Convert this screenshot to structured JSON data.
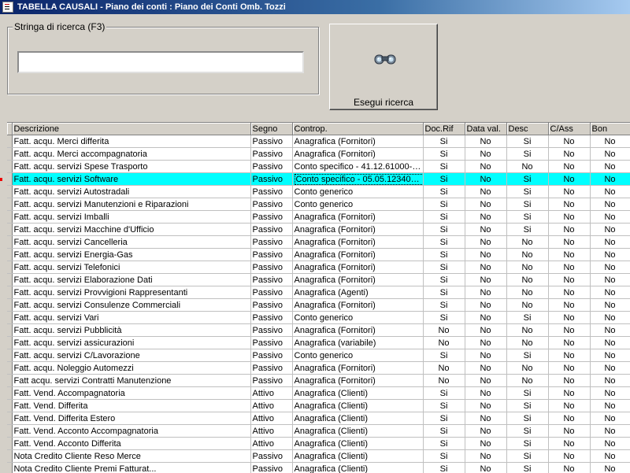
{
  "window": {
    "title": "TABELLA CAUSALI - Piano dei conti : Piano dei Conti Omb. Tozzi"
  },
  "search": {
    "legend": "Stringa di ricerca (F3)",
    "value": "",
    "placeholder": "",
    "button_label": "Esegui ricerca"
  },
  "grid": {
    "columns": [
      "Descrizione",
      "Segno",
      "Controp.",
      "Doc.Rif",
      "Data val.",
      "Desc",
      "C/Ass",
      "Bon"
    ],
    "selected_row": 3,
    "rows": [
      [
        "Fatt. acqu. Merci differita",
        "Passivo",
        "Anagrafica (Fornitori)",
        "Si",
        "No",
        "Si",
        "No",
        "No"
      ],
      [
        "Fatt. acqu. Merci accompagnatoria",
        "Passivo",
        "Anagrafica (Fornitori)",
        "Si",
        "No",
        "Si",
        "No",
        "No"
      ],
      [
        "Fatt. acqu. servizi Spese Trasporto",
        "Passivo",
        "Conto specifico - 41.12.61000-tr...",
        "Si",
        "No",
        "No",
        "No",
        "No"
      ],
      [
        "Fatt. acqu. servizi Software",
        "Passivo",
        "Conto specifico - 05.05.12340-S...",
        "Si",
        "No",
        "Si",
        "No",
        "No"
      ],
      [
        "Fatt. acqu. servizi Autostradali",
        "Passivo",
        "Conto generico",
        "Si",
        "No",
        "Si",
        "No",
        "No"
      ],
      [
        "Fatt. acqu. servizi Manutenzioni e Riparazioni",
        "Passivo",
        "Conto generico",
        "Si",
        "No",
        "Si",
        "No",
        "No"
      ],
      [
        "Fatt. acqu. servizi Imballi",
        "Passivo",
        "Anagrafica (Fornitori)",
        "Si",
        "No",
        "Si",
        "No",
        "No"
      ],
      [
        "Fatt. acqu. servizi Macchine d'Ufficio",
        "Passivo",
        "Anagrafica (Fornitori)",
        "Si",
        "No",
        "Si",
        "No",
        "No"
      ],
      [
        "Fatt. acqu. servizi Cancelleria",
        "Passivo",
        "Anagrafica (Fornitori)",
        "Si",
        "No",
        "No",
        "No",
        "No"
      ],
      [
        "Fatt. acqu. servizi Energia-Gas",
        "Passivo",
        "Anagrafica (Fornitori)",
        "Si",
        "No",
        "No",
        "No",
        "No"
      ],
      [
        "Fatt. acqu. servizi Telefonici",
        "Passivo",
        "Anagrafica (Fornitori)",
        "Si",
        "No",
        "No",
        "No",
        "No"
      ],
      [
        "Fatt. acqu. servizi Elaborazione Dati",
        "Passivo",
        "Anagrafica (Fornitori)",
        "Si",
        "No",
        "No",
        "No",
        "No"
      ],
      [
        "Fatt. acqu. servizi Provvigioni Rappresentanti",
        "Passivo",
        "Anagrafica (Agenti)",
        "Si",
        "No",
        "No",
        "No",
        "No"
      ],
      [
        "Fatt. acqu. servizi Consulenze Commerciali",
        "Passivo",
        "Anagrafica (Fornitori)",
        "Si",
        "No",
        "No",
        "No",
        "No"
      ],
      [
        "Fatt. acqu. servizi Vari",
        "Passivo",
        "Conto generico",
        "Si",
        "No",
        "Si",
        "No",
        "No"
      ],
      [
        "Fatt. acqu. servizi Pubblicità",
        "Passivo",
        "Anagrafica (Fornitori)",
        "No",
        "No",
        "No",
        "No",
        "No"
      ],
      [
        "Fatt. acqu. servizi assicurazioni",
        "Passivo",
        "Anagrafica (variabile)",
        "No",
        "No",
        "No",
        "No",
        "No"
      ],
      [
        "Fatt. acqu. servizi C/Lavorazione",
        "Passivo",
        "Conto generico",
        "Si",
        "No",
        "Si",
        "No",
        "No"
      ],
      [
        "Fatt. acqu. Noleggio Automezzi",
        "Passivo",
        "Anagrafica (Fornitori)",
        "No",
        "No",
        "No",
        "No",
        "No"
      ],
      [
        "Fatt acqu. servizi Contratti Manutenzione",
        "Passivo",
        "Anagrafica (Fornitori)",
        "No",
        "No",
        "No",
        "No",
        "No"
      ],
      [
        "Fatt. Vend. Accompagnatoria",
        "Attivo",
        "Anagrafica (Clienti)",
        "Si",
        "No",
        "Si",
        "No",
        "No"
      ],
      [
        "Fatt. Vend. Differita",
        "Attivo",
        "Anagrafica (Clienti)",
        "Si",
        "No",
        "Si",
        "No",
        "No"
      ],
      [
        "Fatt. Vend. Differita Estero",
        "Attivo",
        "Anagrafica (Clienti)",
        "Si",
        "No",
        "Si",
        "No",
        "No"
      ],
      [
        "Fatt. Vend. Acconto Accompagnatoria",
        "Attivo",
        "Anagrafica (Clienti)",
        "Si",
        "No",
        "Si",
        "No",
        "No"
      ],
      [
        "Fatt. Vend. Acconto Differita",
        "Attivo",
        "Anagrafica (Clienti)",
        "Si",
        "No",
        "Si",
        "No",
        "No"
      ],
      [
        "Nota Credito Cliente Reso Merce",
        "Passivo",
        "Anagrafica (Clienti)",
        "Si",
        "No",
        "Si",
        "No",
        "No"
      ],
      [
        "Nota Credito Cliente Premi Fatturat...",
        "Passivo",
        "Anagrafica (Clienti)",
        "Si",
        "No",
        "Si",
        "No",
        "No"
      ]
    ]
  },
  "colors": {
    "selection": "#00ffff",
    "titlebar_start": "#0a246a",
    "titlebar_end": "#a6caf0"
  }
}
